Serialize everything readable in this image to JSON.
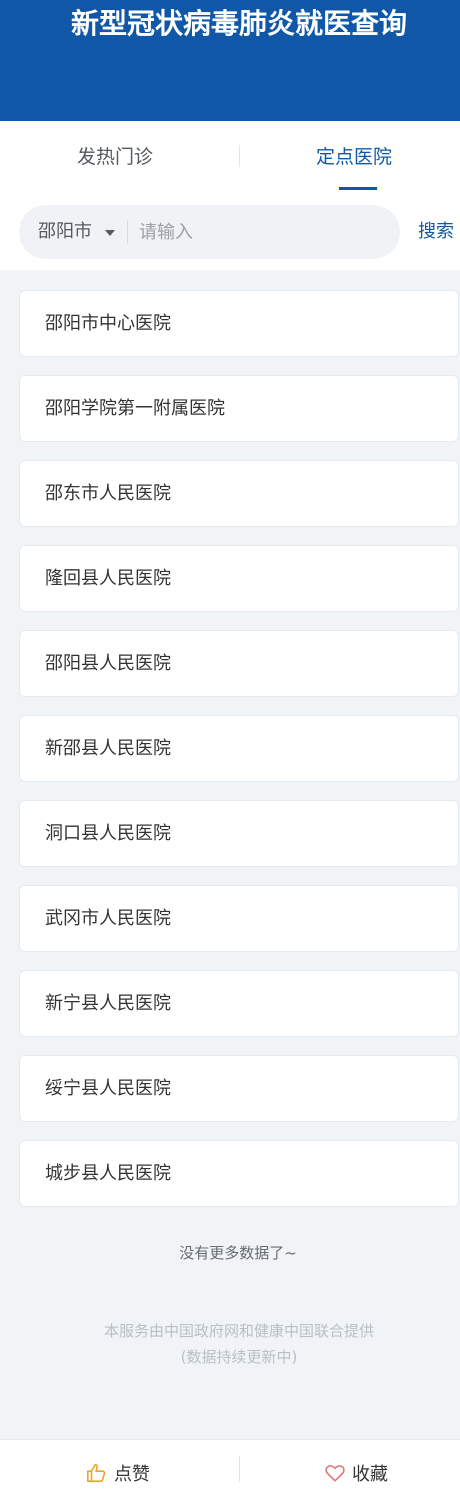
{
  "header": {
    "title": "新型冠状病毒肺炎就医查询"
  },
  "tabs": [
    {
      "label": "发热门诊",
      "active": false
    },
    {
      "label": "定点医院",
      "active": true
    }
  ],
  "search": {
    "city": "邵阳市",
    "placeholder": "请输入",
    "value": "",
    "button_label": "搜索"
  },
  "hospitals": [
    "邵阳市中心医院",
    "邵阳学院第一附属医院",
    "邵东市人民医院",
    "隆回县人民医院",
    "邵阳县人民医院",
    "新邵县人民医院",
    "洞口县人民医院",
    "武冈市人民医院",
    "新宁县人民医院",
    "绥宁县人民医院",
    "城步县人民医院"
  ],
  "status": {
    "no_more": "没有更多数据了~"
  },
  "footer": {
    "line1": "本服务由中国政府网和健康中国联合提供",
    "line2": "(数据持续更新中)"
  },
  "bottom_bar": {
    "like_label": "点赞",
    "favorite_label": "收藏"
  },
  "colors": {
    "primary": "#1058a7",
    "background": "#f0f4f7",
    "like_icon": "#e8a632",
    "favorite_icon": "#e07b7b"
  }
}
